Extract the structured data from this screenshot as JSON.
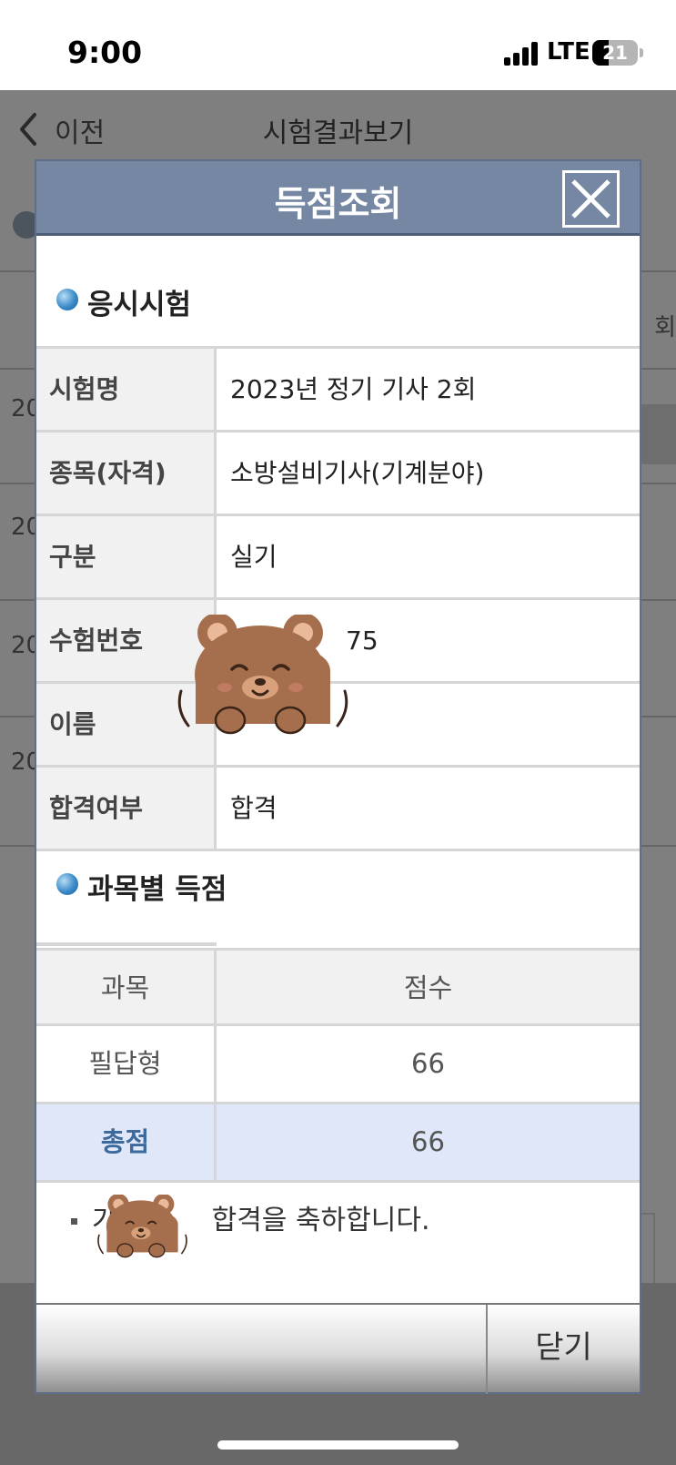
{
  "status_bar": {
    "time": "9:00",
    "network": "LTE",
    "battery": "21"
  },
  "background_page": {
    "back_label": "이전",
    "title": "시험결과보기",
    "column_head_partial": "회",
    "row_year_partials": [
      "20",
      "20",
      "20",
      "20"
    ]
  },
  "modal": {
    "title": "득점조회",
    "exam_section_title": "응시시험",
    "exam_info": [
      {
        "key": "시험명",
        "value": "2023년 정기 기사 2회"
      },
      {
        "key": "종목(자격)",
        "value": "소방설비기사(기계분야)"
      },
      {
        "key": "구분",
        "value": "실기"
      },
      {
        "key": "수험번호",
        "value": "75"
      },
      {
        "key": "이름",
        "value": ""
      },
      {
        "key": "합격여부",
        "value": "합격"
      }
    ],
    "score_section_title": "과목별 득점",
    "score_header": {
      "subject": "과목",
      "score": "점수"
    },
    "scores": [
      {
        "subject": "필답형",
        "score": "66"
      }
    ],
    "total": {
      "label": "총점",
      "score": "66"
    },
    "notice_prefix": "가",
    "notice_text": "합격을 축하합니다.",
    "close_button": "닫기"
  },
  "colors": {
    "header": "#7587a3",
    "total_row": "#dfe7f9",
    "total_label": "#3d6a9c",
    "dim_overlay": "rgba(0,0,0,0.5)"
  }
}
